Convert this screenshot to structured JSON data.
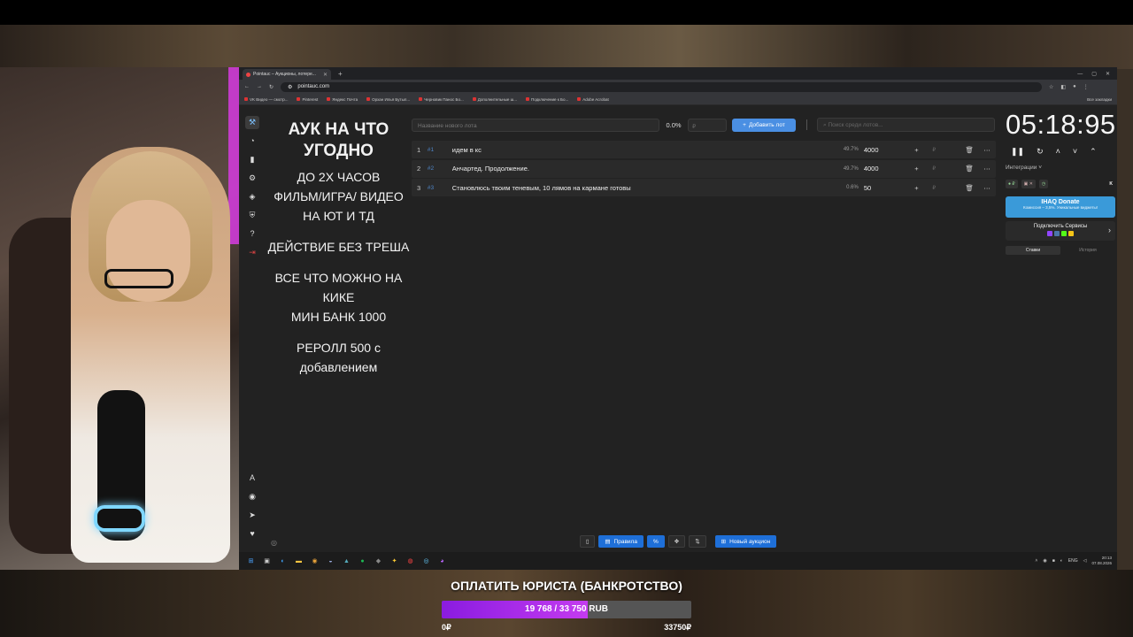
{
  "browser": {
    "tab_title": "Pointauc – Аукционы, лотере...",
    "url": "pointauc.com",
    "bookmarks": [
      "VK Видео — смотр...",
      "Pinterest",
      "Яндекс Почта",
      "Орхан Илья Бутыл...",
      "Черновик Панос Бо...",
      "Дополнительные ш...",
      "Подключение к Бо...",
      "Adobe Acrobat"
    ],
    "bookmarks_right": "Все закладки"
  },
  "rules": {
    "title": "АУК НА ЧТО УГОДНО",
    "line1": "ДО 2Х ЧАСОВ",
    "line2": "ФИЛЬМ/ИГРА/ ВИДЕО НА ЮТ И ТД",
    "line3": "ДЕЙСТВИЕ БЕЗ ТРЕША",
    "line4": "ВСЕ ЧТО МОЖНО НА КИКЕ",
    "line5": "МИН БАНК 1000",
    "line6": "РЕРОЛЛ 500 с добавлением"
  },
  "lot_form": {
    "name_placeholder": "Название нового лота",
    "percent": "0.0%",
    "sum_placeholder": "₽",
    "add_label": "Добавить лот",
    "search_placeholder": "Поиск среди лотов..."
  },
  "lots": [
    {
      "n": "1",
      "id": "#1",
      "name": "идем в кс",
      "pct": "49.7%",
      "amount": "4000"
    },
    {
      "n": "2",
      "id": "#2",
      "name": "Анчартед. Продолжение.",
      "pct": "49.7%",
      "amount": "4000"
    },
    {
      "n": "3",
      "id": "#3",
      "name": "Становлюсь твоим теневым, 10 лямов на кармане готовы",
      "pct": "0.6%",
      "amount": "50"
    }
  ],
  "timer": {
    "value": "05:18:95",
    "integrations_label": "Интеграции",
    "donate_title": "IHAQ Donate",
    "donate_sub": "Комиссия – 3,5%. Уникальные виджеты!",
    "connect_label": "Подключить Сервисы",
    "tab_bids": "Ставки",
    "tab_history": "История"
  },
  "bottom_bar": {
    "rules_label": "Правила",
    "percent_label": "%",
    "new_auction_label": "Новый аукцион"
  },
  "taskbar": {
    "lang": "ENG",
    "time": "20:13",
    "date": "07.08.2026"
  },
  "goal": {
    "title": "ОПЛАТИТЬ ЮРИСТА (БАНКРОТСТВО)",
    "progress_text": "19 768 / 33 750 RUB",
    "current": 19768,
    "target": 33750,
    "min_label": "0₽",
    "max_label": "33750₽"
  },
  "colors": {
    "accent": "#4a8fe3",
    "donate": "#3a9ad9",
    "goal_fill": "#a52ee8"
  }
}
